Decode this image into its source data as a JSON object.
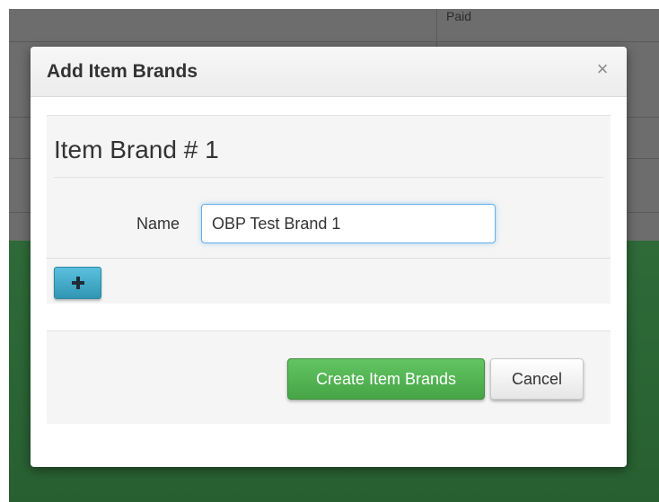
{
  "background": {
    "table_cell_text": "Paid"
  },
  "modal": {
    "title": "Add Item Brands",
    "close_symbol": "×",
    "section_heading": "Item Brand # 1",
    "name_label": "Name",
    "name_value": "OBP Test Brand 1",
    "add_button_icon": "plus-icon",
    "create_label": "Create Item Brands",
    "cancel_label": "Cancel"
  },
  "colors": {
    "primary_green": "#5cb85c",
    "info_blue": "#5bc0de",
    "focus_blue": "#66afe9"
  }
}
